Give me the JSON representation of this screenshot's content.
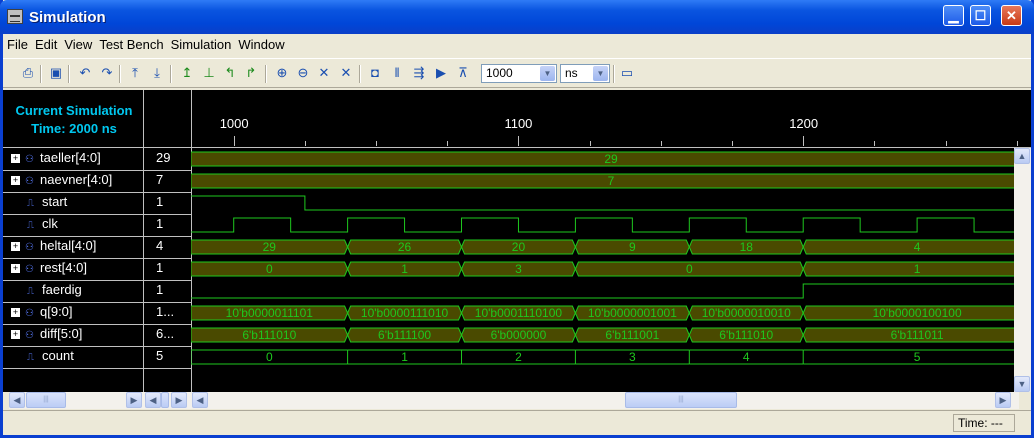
{
  "window": {
    "title": "Simulation"
  },
  "menu": [
    "File",
    "Edit",
    "View",
    "Test Bench",
    "Simulation",
    "Window"
  ],
  "toolbar": {
    "time_value": "1000",
    "time_unit": "ns",
    "icons": [
      "print-icon",
      "save-icon",
      "undo-icon",
      "redo-icon",
      "step-back-icon",
      "step-over-icon",
      "add-marker-icon",
      "bench-icon",
      "jump-prev-icon",
      "jump-next-icon",
      "zoom-in-icon",
      "zoom-out-icon",
      "zoom-fit-icon",
      "zoom-full-icon",
      "restart-icon",
      "pause-icon",
      "step-icon",
      "run-icon",
      "run-for-icon",
      "window-icon"
    ]
  },
  "current_simulation": {
    "line1": "Current Simulation",
    "line2": "Time: 2000 ns"
  },
  "timeline": {
    "ticks": [
      {
        "label": "1000",
        "t": 1000
      },
      {
        "label": "1100",
        "t": 1100
      },
      {
        "label": "1200",
        "t": 1200
      }
    ],
    "t_start": 985,
    "t_end": 1280
  },
  "signals": [
    {
      "name": "taeller[4:0]",
      "value": "29",
      "bus": true,
      "segments": [
        {
          "from": 985,
          "to": 1280,
          "label": "29"
        }
      ]
    },
    {
      "name": "naevner[4:0]",
      "value": "7",
      "bus": true,
      "segments": [
        {
          "from": 985,
          "to": 1280,
          "label": "7"
        }
      ]
    },
    {
      "name": "start",
      "value": "1",
      "bus": false,
      "edges": [
        985,
        1025
      ],
      "init": 1
    },
    {
      "name": "clk",
      "value": "1",
      "bus": false,
      "init": 0,
      "edges": [
        1000,
        1020,
        1040,
        1060,
        1080,
        1100,
        1120,
        1140,
        1160,
        1180,
        1200,
        1220,
        1240,
        1260,
        1280
      ]
    },
    {
      "name": "heltal[4:0]",
      "value": "4",
      "bus": true,
      "segments": [
        {
          "from": 985,
          "to": 1040,
          "label": "29"
        },
        {
          "from": 1040,
          "to": 1080,
          "label": "26"
        },
        {
          "from": 1080,
          "to": 1120,
          "label": "20"
        },
        {
          "from": 1120,
          "to": 1160,
          "label": "9"
        },
        {
          "from": 1160,
          "to": 1200,
          "label": "18"
        },
        {
          "from": 1200,
          "to": 1280,
          "label": "4"
        }
      ]
    },
    {
      "name": "rest[4:0]",
      "value": "1",
      "bus": true,
      "segments": [
        {
          "from": 985,
          "to": 1040,
          "label": "0"
        },
        {
          "from": 1040,
          "to": 1080,
          "label": "1"
        },
        {
          "from": 1080,
          "to": 1120,
          "label": "3"
        },
        {
          "from": 1120,
          "to": 1200,
          "label": "0"
        },
        {
          "from": 1200,
          "to": 1280,
          "label": "1"
        }
      ]
    },
    {
      "name": "faerdig",
      "value": "1",
      "bus": false,
      "init": 0,
      "edges": [
        1200
      ]
    },
    {
      "name": "q[9:0]",
      "value": "1...",
      "bus": true,
      "segments": [
        {
          "from": 985,
          "to": 1040,
          "label": "10'b0000011101"
        },
        {
          "from": 1040,
          "to": 1080,
          "label": "10'b0000111010"
        },
        {
          "from": 1080,
          "to": 1120,
          "label": "10'b0001110100"
        },
        {
          "from": 1120,
          "to": 1160,
          "label": "10'b0000001001"
        },
        {
          "from": 1160,
          "to": 1200,
          "label": "10'b0000010010"
        },
        {
          "from": 1200,
          "to": 1280,
          "label": "10'b0000100100"
        }
      ]
    },
    {
      "name": "diff[5:0]",
      "value": "6...",
      "bus": true,
      "segments": [
        {
          "from": 985,
          "to": 1040,
          "label": "6'b111010"
        },
        {
          "from": 1040,
          "to": 1080,
          "label": "6'b111100"
        },
        {
          "from": 1080,
          "to": 1120,
          "label": "6'b000000"
        },
        {
          "from": 1120,
          "to": 1160,
          "label": "6'b111001"
        },
        {
          "from": 1160,
          "to": 1200,
          "label": "6'b111010"
        },
        {
          "from": 1200,
          "to": 1280,
          "label": "6'b111011"
        }
      ]
    },
    {
      "name": "count",
      "value": "5",
      "bus": true,
      "plain": true,
      "segments": [
        {
          "from": 985,
          "to": 1040,
          "label": "0"
        },
        {
          "from": 1040,
          "to": 1080,
          "label": "1"
        },
        {
          "from": 1080,
          "to": 1120,
          "label": "2"
        },
        {
          "from": 1120,
          "to": 1160,
          "label": "3"
        },
        {
          "from": 1160,
          "to": 1200,
          "label": "4"
        },
        {
          "from": 1200,
          "to": 1280,
          "label": "5"
        }
      ]
    }
  ],
  "status": {
    "time": "Time: ---"
  },
  "colors": {
    "wave": "#1ec81e",
    "bus_fill": "#4a4a00",
    "cyan_label": "#00c8f0"
  }
}
